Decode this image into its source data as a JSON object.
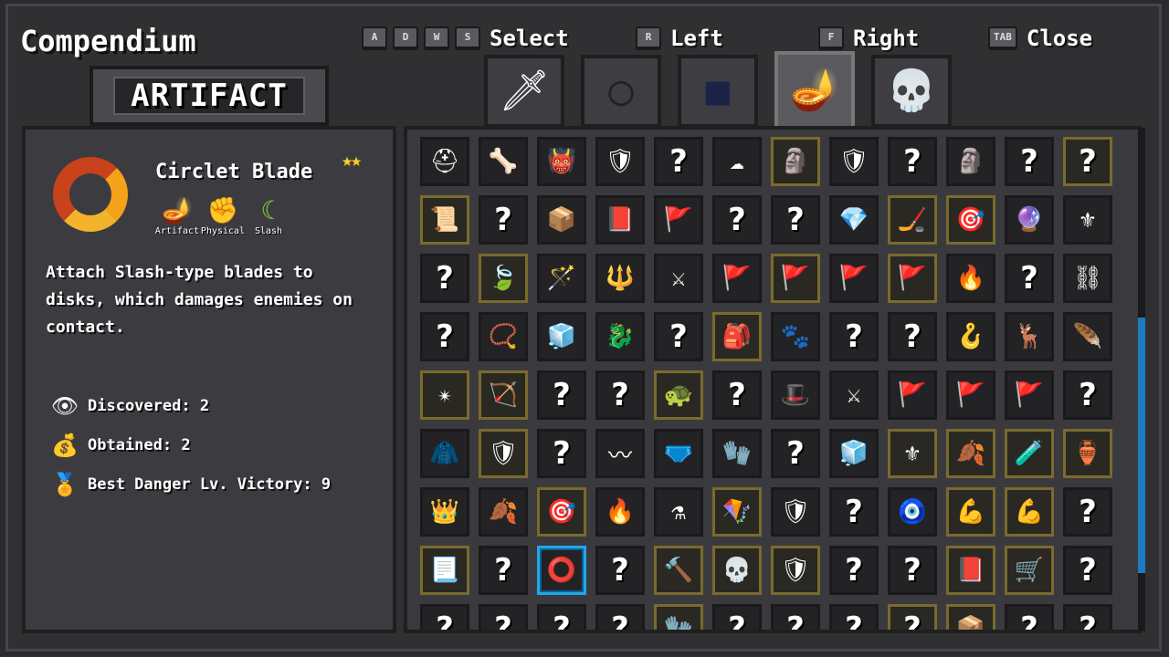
{
  "title": "Compendium",
  "hints": [
    {
      "keys": [
        "A",
        "D",
        "W",
        "S"
      ],
      "label": "Select"
    },
    {
      "keys": [
        "R"
      ],
      "label": "Left"
    },
    {
      "keys": [
        "F"
      ],
      "label": "Right"
    },
    {
      "keys": [
        "TAB"
      ],
      "label": "Close"
    }
  ],
  "category": "ARTIFACT",
  "tabs": [
    {
      "icon": "sword-icon",
      "glyph": "🗡",
      "active": false
    },
    {
      "icon": "circle-icon",
      "glyph": "◯",
      "active": false
    },
    {
      "icon": "square-icon",
      "glyph": "■",
      "active": false
    },
    {
      "icon": "lamp-icon",
      "glyph": "🪔",
      "active": true
    },
    {
      "icon": "mask-icon",
      "glyph": "💀",
      "active": false
    }
  ],
  "selected_item": {
    "name": "Circlet Blade",
    "stars": "★★",
    "tags": [
      {
        "icon": "lamp-icon",
        "glyph": "🪔",
        "label": "Artifact"
      },
      {
        "icon": "fist-icon",
        "glyph": "✊",
        "label": "Physical"
      },
      {
        "icon": "crescent-icon",
        "glyph": "☾",
        "label": "Slash"
      }
    ],
    "description": "Attach Slash-type blades to disks, which damages enemies on contact.",
    "stats": [
      {
        "icon": "eye-icon",
        "glyph": "👁",
        "label": "Discovered: 2"
      },
      {
        "icon": "bag-icon",
        "glyph": "💰",
        "label": "Obtained: 2"
      },
      {
        "icon": "medal-icon",
        "glyph": "🏅",
        "label": "Best Danger Lv. Victory: 9"
      }
    ]
  },
  "grid": [
    [
      "helm",
      "claws",
      "mask",
      "armor",
      "?",
      "cloud",
      "totem",
      "shield",
      "?",
      "bust",
      "?",
      "?"
    ],
    [
      "scroll",
      "?",
      "box",
      "book",
      "banner",
      "?",
      "?",
      "gem",
      "staff",
      "target",
      "orb",
      "crest"
    ],
    [
      "?",
      "leaf",
      "wand",
      "wand2",
      "sword",
      "banner",
      "banner",
      "banner",
      "banner",
      "hood",
      "?",
      "chain"
    ],
    [
      "?",
      "pendant",
      "cube",
      "dragon",
      "?",
      "bag",
      "paw",
      "?",
      "?",
      "hook",
      "horns",
      "claw"
    ],
    [
      "rune",
      "bow",
      "?",
      "?",
      "shell",
      "?",
      "hat",
      "sword",
      "banner",
      "banner",
      "banner",
      "?"
    ],
    [
      "cloak",
      "shield",
      "?",
      "stick",
      "belt",
      "glove",
      "?",
      "cube",
      "crest",
      "feather",
      "potion",
      "jar"
    ],
    [
      "crown",
      "feather",
      "arrows",
      "fire",
      "vial",
      "kite",
      "shield",
      "?",
      "eye",
      "arm",
      "arm",
      "?"
    ],
    [
      "paper",
      "?",
      "ring",
      "?",
      "hammer",
      "skull",
      "armor",
      "?",
      "?",
      "book",
      "cart",
      "?"
    ],
    [
      "?",
      "?",
      "?",
      "?",
      "glove",
      "?",
      "?",
      "?",
      "?",
      "box",
      "?",
      "?"
    ]
  ],
  "grid_gold": [
    [
      false,
      false,
      false,
      false,
      false,
      false,
      true,
      false,
      false,
      false,
      false,
      true
    ],
    [
      true,
      false,
      false,
      false,
      false,
      false,
      false,
      false,
      true,
      true,
      false,
      false
    ],
    [
      false,
      true,
      false,
      false,
      false,
      false,
      true,
      false,
      true,
      false,
      false,
      false
    ],
    [
      false,
      false,
      false,
      false,
      false,
      true,
      false,
      false,
      false,
      false,
      false,
      false
    ],
    [
      true,
      true,
      false,
      false,
      true,
      false,
      false,
      false,
      false,
      false,
      false,
      false
    ],
    [
      false,
      true,
      false,
      false,
      false,
      false,
      false,
      false,
      true,
      true,
      true,
      true
    ],
    [
      false,
      false,
      true,
      false,
      false,
      true,
      false,
      false,
      false,
      true,
      true,
      false
    ],
    [
      true,
      false,
      false,
      false,
      true,
      true,
      true,
      false,
      false,
      true,
      true,
      false
    ],
    [
      false,
      false,
      false,
      false,
      true,
      false,
      false,
      false,
      true,
      true,
      false,
      false
    ]
  ],
  "selected_cell": [
    7,
    2
  ],
  "glyphs": {
    "helm": "⛑",
    "claws": "🦴",
    "mask": "👹",
    "armor": "🛡",
    "cloud": "☁",
    "totem": "🗿",
    "shield": "🛡",
    "bust": "🗿",
    "scroll": "📜",
    "box": "📦",
    "book": "📕",
    "banner": "🚩",
    "gem": "💎",
    "staff": "🏒",
    "target": "🎯",
    "orb": "🔮",
    "crest": "⚜",
    "leaf": "🍃",
    "wand": "🪄",
    "wand2": "🔱",
    "sword": "⚔",
    "hood": "🔥",
    "chain": "⛓",
    "pendant": "📿",
    "cube": "🧊",
    "dragon": "🐉",
    "bag": "🎒",
    "paw": "🐾",
    "hook": "🪝",
    "horns": "🦌",
    "claw": "🪶",
    "rune": "✴",
    "bow": "🏹",
    "shell": "🐢",
    "hat": "🎩",
    "cloak": "🧥",
    "stick": "〰",
    "belt": "🩲",
    "glove": "🧤",
    "feather": "🍂",
    "potion": "🧪",
    "jar": "🏺",
    "crown": "👑",
    "arrows": "🎯",
    "fire": "🔥",
    "vial": "⚗",
    "kite": "🪁",
    "eye": "🧿",
    "arm": "💪",
    "paper": "📃",
    "ring": "⭕",
    "hammer": "🔨",
    "skull": "💀",
    "cart": "🛒"
  }
}
